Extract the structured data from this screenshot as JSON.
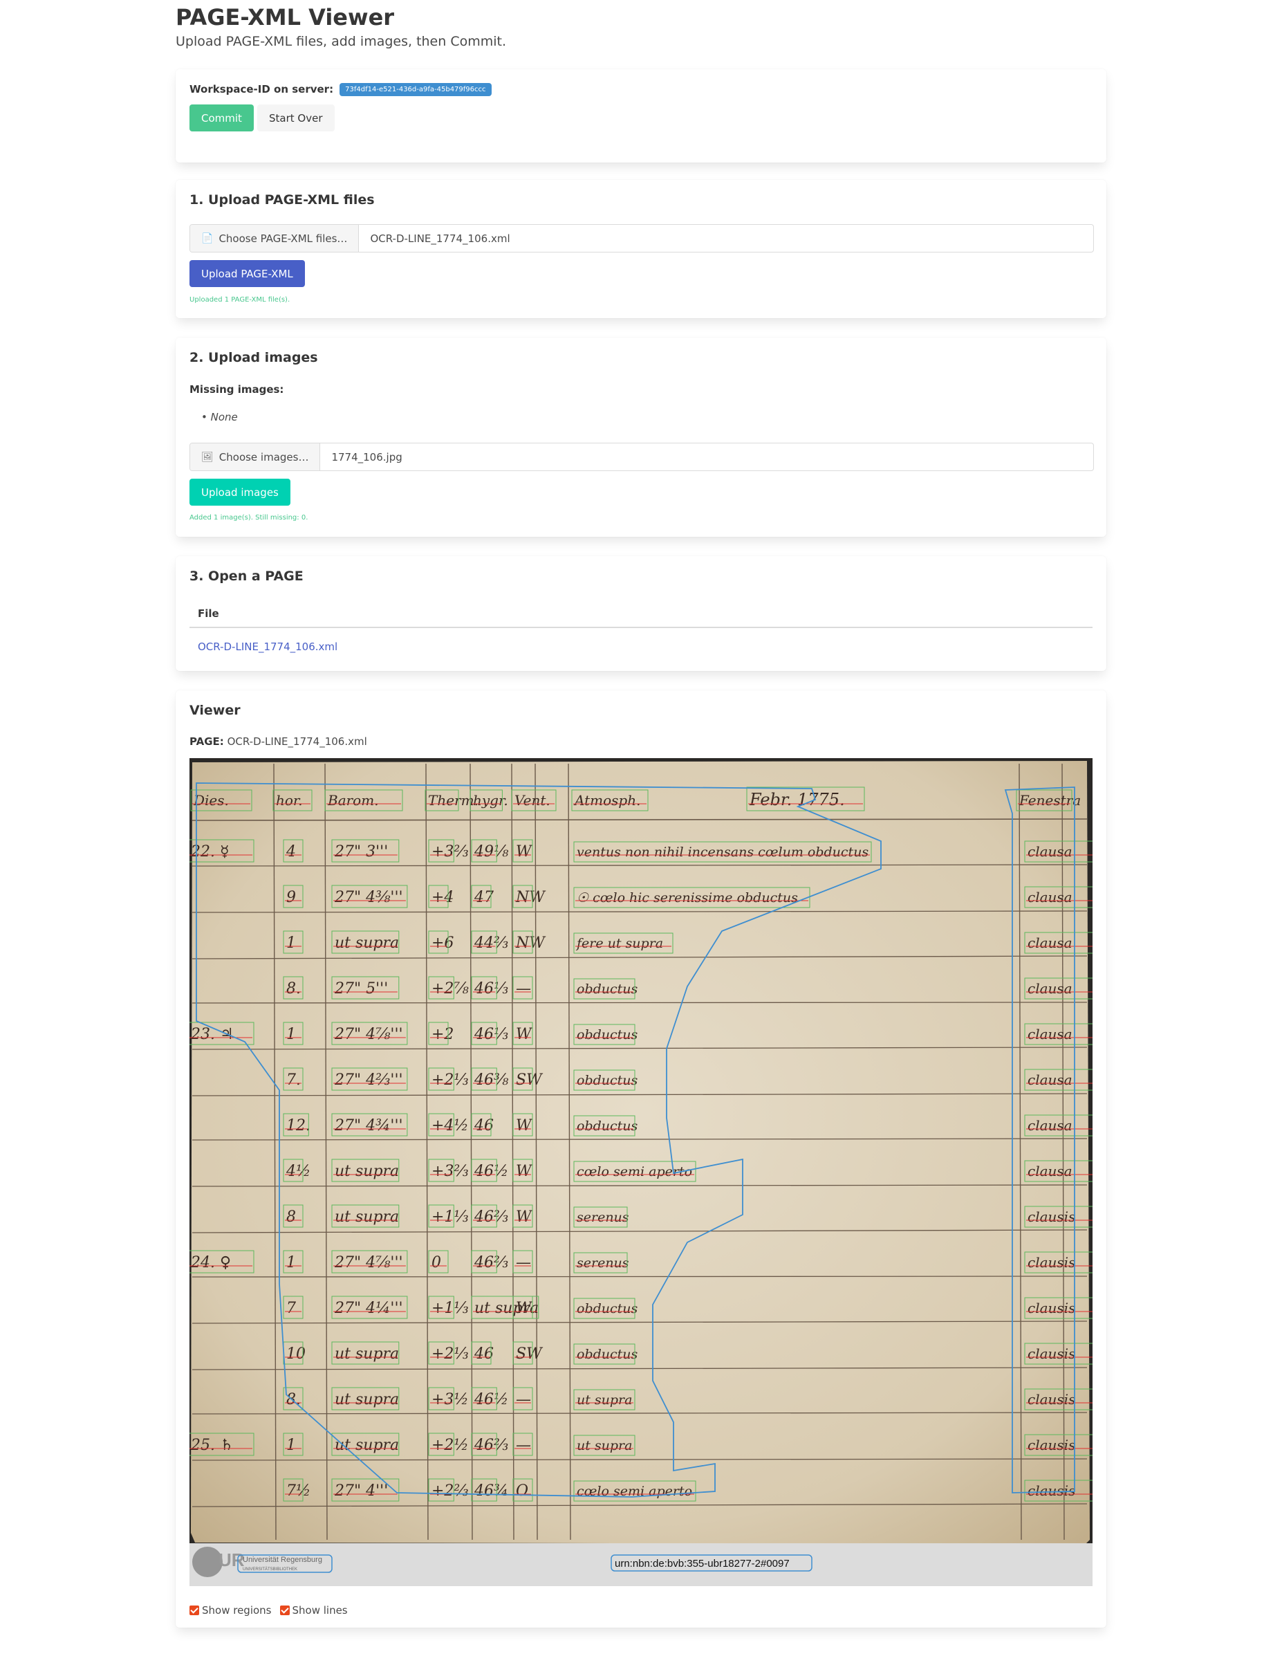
{
  "app": {
    "title": "PAGE-XML Viewer",
    "subtitle": "Upload PAGE-XML files, add images, then Commit."
  },
  "workspace": {
    "label": "Workspace-ID on server:",
    "id": "73f4df14-e521-436d-a9fa-45b479f96ccc",
    "commit_label": "Commit",
    "start_over_label": "Start Over"
  },
  "upload_xml": {
    "title": "1. Upload PAGE-XML files",
    "choose_label": "Choose PAGE-XML files…",
    "file_name": "OCR-D-LINE_1774_106.xml",
    "button_label": "Upload PAGE-XML",
    "status": "Uploaded 1 PAGE-XML file(s)."
  },
  "upload_images": {
    "title": "2. Upload images",
    "missing_label": "Missing images:",
    "missing_items": [
      "None"
    ],
    "choose_label": "Choose images…",
    "file_name": "1774_106.jpg",
    "button_label": "Upload images",
    "status": "Added 1 image(s). Still missing: 0."
  },
  "open_page": {
    "title": "3. Open a PAGE",
    "column_header": "File",
    "files": [
      "OCR-D-LINE_1774_106.xml"
    ]
  },
  "viewer": {
    "title": "Viewer",
    "page_label": "PAGE:",
    "page_name": "OCR-D-LINE_1774_106.xml",
    "footer_logo": "Universität Regensburg",
    "footer_logo_sub": "UNIVERSITÄTSBIBLIOTHEK",
    "footer_urn": "urn:nbn:de:bvb:355-ubr18277-2#0097",
    "manuscript": {
      "header": [
        "Dies.",
        "hor.",
        "Barom.",
        "Therm.",
        "hygr.",
        "Vent.",
        "Atmosph.",
        "Febr. 1775.",
        "Fenestra"
      ],
      "rows": [
        {
          "day": "22. ☿",
          "hor": "4",
          "bar": "27\" 3'''",
          "therm": "+3⅔",
          "hygr": "49⅛",
          "vent": "W",
          "atm": "ventus non nihil incensans cœlum obductus",
          "fen": "clausa"
        },
        {
          "day": "",
          "hor": "9",
          "bar": "27\" 4⅜'''",
          "therm": "+4",
          "hygr": "47",
          "vent": "NW",
          "atm": "☉ cœlo hic serenissime obductus",
          "fen": "clausa"
        },
        {
          "day": "",
          "hor": "1",
          "bar": "ut supra",
          "therm": "+6",
          "hygr": "44⅔",
          "vent": "NW",
          "atm": "fere ut supra",
          "fen": "clausa"
        },
        {
          "day": "",
          "hor": "8.",
          "bar": "27\" 5'''",
          "therm": "+2⅞",
          "hygr": "46⅓",
          "vent": "—",
          "atm": "obductus",
          "fen": "clausa"
        },
        {
          "day": "23. ♃",
          "hor": "1",
          "bar": "27\" 4⅞'''",
          "therm": "+2",
          "hygr": "46⅓",
          "vent": "W",
          "atm": "obductus",
          "fen": "clausa"
        },
        {
          "day": "",
          "hor": "7.",
          "bar": "27\" 4⅔'''",
          "therm": "+2⅓",
          "hygr": "46⅜",
          "vent": "SW",
          "atm": "obductus",
          "fen": "clausa"
        },
        {
          "day": "",
          "hor": "12.",
          "bar": "27\" 4¾'''",
          "therm": "+4½",
          "hygr": "46",
          "vent": "W",
          "atm": "obductus",
          "fen": "clausa"
        },
        {
          "day": "",
          "hor": "4½",
          "bar": "ut supra",
          "therm": "+3⅔",
          "hygr": "46½",
          "vent": "W",
          "atm": "cœlo semi aperto",
          "fen": "clausa"
        },
        {
          "day": "",
          "hor": "8",
          "bar": "ut supra",
          "therm": "+1⅓",
          "hygr": "46⅔",
          "vent": "W",
          "atm": "serenus",
          "fen": "clausis"
        },
        {
          "day": "24. ♀",
          "hor": "1",
          "bar": "27\" 4⅞'''",
          "therm": "0",
          "hygr": "46⅔",
          "vent": "—",
          "atm": "serenus",
          "fen": "clausis"
        },
        {
          "day": "",
          "hor": "7",
          "bar": "27\" 4¼'''",
          "therm": "+1⅓",
          "hygr": "ut supra",
          "vent": "W",
          "atm": "obductus",
          "fen": "clausis"
        },
        {
          "day": "",
          "hor": "10",
          "bar": "ut supra",
          "therm": "+2⅓",
          "hygr": "46",
          "vent": "SW",
          "atm": "obductus",
          "fen": "clausis"
        },
        {
          "day": "",
          "hor": "8.",
          "bar": "ut supra",
          "therm": "+3½",
          "hygr": "46½",
          "vent": "—",
          "atm": "ut supra",
          "fen": "clausis"
        },
        {
          "day": "25. ♄",
          "hor": "1",
          "bar": "ut supra",
          "therm": "+2½",
          "hygr": "46⅔",
          "vent": "—",
          "atm": "ut supra",
          "fen": "clausis"
        },
        {
          "day": "",
          "hor": "7½",
          "bar": "27\" 4'''",
          "therm": "+2⅔",
          "hygr": "46¾",
          "vent": "O",
          "atm": "cœlo semi aperto",
          "fen": "clausis"
        }
      ]
    },
    "show_regions_label": "Show regions",
    "show_lines_label": "Show lines",
    "show_regions": true,
    "show_lines": true
  },
  "colors": {
    "primary": "#485fc7",
    "success": "#48c78e",
    "teal": "#00d1b2",
    "info": "#3e8ed0",
    "region_outline": "#3e8ed0",
    "line_outline": "#5cb85c",
    "baseline": "#e03030"
  }
}
